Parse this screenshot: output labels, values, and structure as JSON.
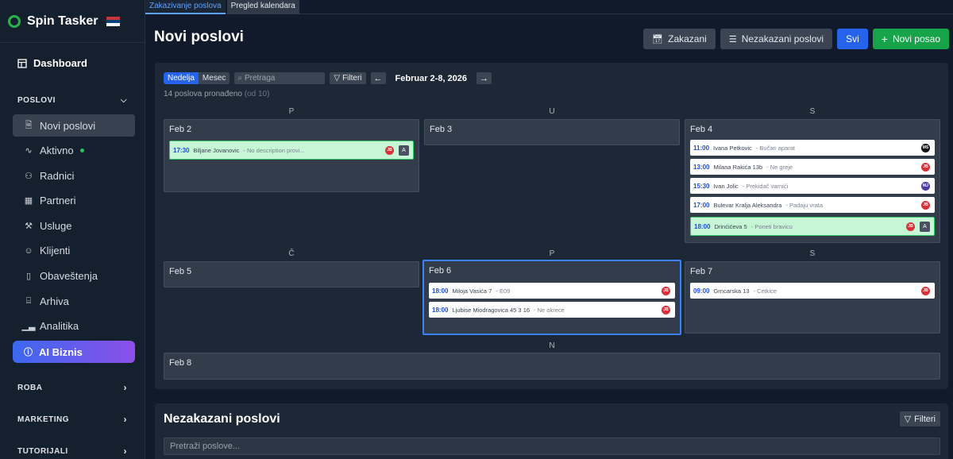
{
  "brand": {
    "name": "Spin Tasker"
  },
  "sidebar": {
    "dashboard": "Dashboard",
    "section_poslovi": "POSLOVI",
    "items": [
      {
        "label": "Novi poslovi",
        "icon": "document-icon"
      },
      {
        "label": "Aktivno",
        "icon": "activity-icon"
      },
      {
        "label": "Radnici",
        "icon": "user-plus-icon"
      },
      {
        "label": "Partneri",
        "icon": "building-icon"
      },
      {
        "label": "Usluge",
        "icon": "wrench-icon"
      },
      {
        "label": "Klijenti",
        "icon": "user-icon"
      },
      {
        "label": "Obaveštenja",
        "icon": "file-icon"
      },
      {
        "label": "Arhiva",
        "icon": "archive-icon"
      },
      {
        "label": "Analitika",
        "icon": "bar-chart-icon"
      }
    ],
    "ai": "AI Biznis",
    "section_roba": "ROBA",
    "section_marketing": "MARKETING",
    "section_tutorijali": "TUTORIJALI"
  },
  "tabs": [
    "Zakazivanje poslova",
    "Pregled kalendara"
  ],
  "header": {
    "title": "Novi poslovi",
    "btn_zakazani": "Zakazani",
    "btn_nezakazani": "Nezakazani poslovi",
    "btn_svi": "Svi",
    "btn_novi": "Novi posao"
  },
  "toolbar": {
    "view_week": "Nedelja",
    "view_month": "Mesec",
    "search_placeholder": "Pretraga",
    "filters": "Filteri",
    "prev": "←",
    "next": "→",
    "week_label": "Februar 2-8, 2026",
    "count": "14 poslova pronađeno",
    "count_total": "(od 10)"
  },
  "days": [
    {
      "name": "P",
      "label": "Feb 2"
    },
    {
      "name": "U",
      "label": "Feb 3"
    },
    {
      "name": "S",
      "label": "Feb 4"
    },
    {
      "name": "Č",
      "label": "Feb 5"
    },
    {
      "name": "P",
      "label": "Feb 6"
    },
    {
      "name": "S",
      "label": "Feb 7"
    },
    {
      "name": "N",
      "label": "Feb 8"
    }
  ],
  "events": {
    "feb2": [
      {
        "time": "17:30",
        "title": "Biljane Jovanovic",
        "desc": "- No description provi...",
        "avatar": "JB",
        "badge": "A"
      }
    ],
    "feb4": [
      {
        "time": "11:00",
        "title": "Ivana Petkovic",
        "desc": "- Bučan aparat",
        "avatar": "MS"
      },
      {
        "time": "13:00",
        "title": "Milana Rakića 13b",
        "desc": "- Ne greje",
        "avatar": "JB"
      },
      {
        "time": "15:30",
        "title": "Ivan Jolic",
        "desc": "- Prekidač varnići",
        "avatar": "MJ"
      },
      {
        "time": "17:00",
        "title": "Bulevar Kralja Aleksandra",
        "desc": "- Padaju vrata",
        "avatar": "JB"
      },
      {
        "time": "18:00",
        "title": "Drinćićeva 5",
        "desc": "- Poneti bravicu",
        "avatar": "JB",
        "badge": "A"
      }
    ],
    "feb6": [
      {
        "time": "18:00",
        "title": "Miloja Vasića 7",
        "desc": "- E09",
        "avatar": "JB"
      },
      {
        "time": "18:00",
        "title": "Ljubise Miodragovica 45 3 16",
        "desc": "- Ne okrece",
        "avatar": "JB"
      }
    ],
    "feb7": [
      {
        "time": "09:00",
        "title": "Grncarska 13",
        "desc": "- Cetkice",
        "avatar": "JB"
      }
    ]
  },
  "bottom": {
    "title": "Nezakazani poslovi",
    "filters": "Filteri",
    "search_placeholder": "Pretraži poslove..."
  },
  "colors": {
    "accent": "#2563eb",
    "success": "#16a34a",
    "event_green": "#c6f6d5"
  }
}
